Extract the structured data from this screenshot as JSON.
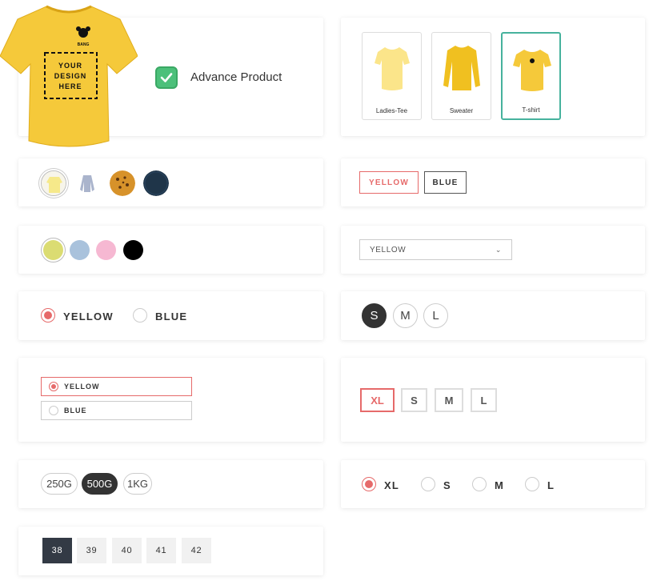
{
  "advance_product": {
    "label": "Advance Product",
    "checked": true,
    "hero_shirt_text": "YOUR\nDESIGN\nHERE",
    "hero_shirt_logo_text": "BANG"
  },
  "variant_images": [
    {
      "label": "Ladies-Tee",
      "selected": false
    },
    {
      "label": "Sweater",
      "selected": false
    },
    {
      "label": "T-shirt",
      "selected": true
    }
  ],
  "image_swatches": [
    {
      "name": "yellow-tee",
      "selected": true
    },
    {
      "name": "blue-sweater",
      "selected": false
    },
    {
      "name": "cookie",
      "selected": false
    },
    {
      "name": "navy",
      "selected": false
    }
  ],
  "button_swatches": [
    {
      "label": "YELLOW",
      "selected": true
    },
    {
      "label": "BLUE",
      "selected": false
    }
  ],
  "color_circles": [
    {
      "color": "#dbdc72",
      "selected": true
    },
    {
      "color": "#a9c2dc",
      "selected": false
    },
    {
      "color": "#f6b8d2",
      "selected": false
    },
    {
      "color": "#000000",
      "selected": false
    }
  ],
  "dropdown": {
    "value": "YELLOW"
  },
  "radio_colors": [
    {
      "label": "YELLOW",
      "checked": true
    },
    {
      "label": "BLUE",
      "checked": false
    }
  ],
  "size_circles": [
    {
      "label": "S",
      "selected": true
    },
    {
      "label": "M",
      "selected": false
    },
    {
      "label": "L",
      "selected": false
    }
  ],
  "radio_boxes": [
    {
      "label": "YELLOW",
      "checked": true
    },
    {
      "label": "BLUE",
      "checked": false
    }
  ],
  "size_squares": [
    {
      "label": "XL",
      "selected": true
    },
    {
      "label": "S",
      "selected": false
    },
    {
      "label": "M",
      "selected": false
    },
    {
      "label": "L",
      "selected": false
    }
  ],
  "weight_pills": [
    {
      "label": "250G",
      "selected": false
    },
    {
      "label": "500G",
      "selected": true
    },
    {
      "label": "1KG",
      "selected": false
    }
  ],
  "radio_sizes": [
    {
      "label": "XL",
      "checked": true
    },
    {
      "label": "S",
      "checked": false
    },
    {
      "label": "M",
      "checked": false
    },
    {
      "label": "L",
      "checked": false
    }
  ],
  "number_boxes": [
    {
      "label": "38",
      "selected": true
    },
    {
      "label": "39",
      "selected": false
    },
    {
      "label": "40",
      "selected": false
    },
    {
      "label": "41",
      "selected": false
    },
    {
      "label": "42",
      "selected": false
    }
  ],
  "colors": {
    "accent_red": "#e66a6a",
    "accent_teal": "#46b29d",
    "check_green": "#4cc07a",
    "dark": "#333333",
    "shirt_yellow": "#f5c93a"
  }
}
